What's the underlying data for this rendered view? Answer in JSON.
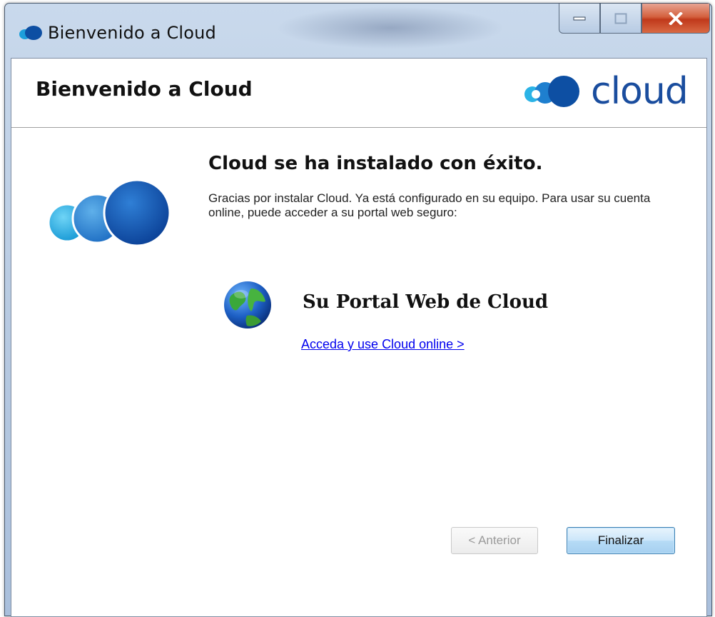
{
  "window": {
    "title": "Bienvenido a Cloud",
    "controls": [
      "minimize",
      "maximize",
      "close"
    ]
  },
  "header": {
    "title": "Bienvenido a Cloud",
    "brand": "cloud"
  },
  "content": {
    "heading": "Cloud se ha instalado con éxito.",
    "description": "Gracias por instalar Cloud. Ya está configurado en su equipo. Para usar su cuenta online, puede acceder a su portal web seguro:",
    "portal_title": "Su Portal Web de Cloud",
    "portal_link": "Acceda y use Cloud online >"
  },
  "buttons": {
    "back": "< Anterior",
    "finish": "Finalizar"
  },
  "colors": {
    "link": "#0000ee",
    "brand_blue": "#1a4d9e",
    "accent_cyan": "#2bb3e6"
  }
}
